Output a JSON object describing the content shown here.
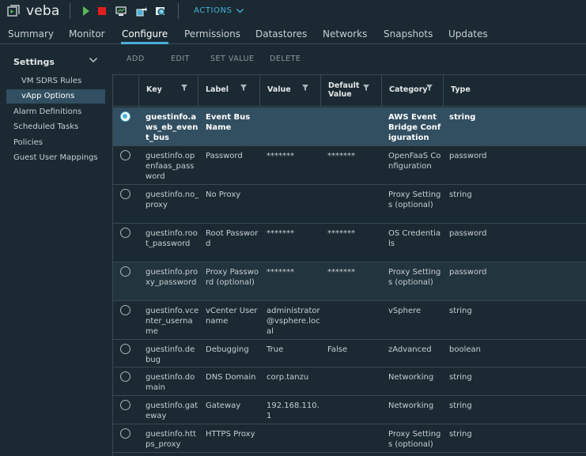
{
  "header": {
    "title": "veba",
    "actions_label": "ACTIONS"
  },
  "tabs": [
    "Summary",
    "Monitor",
    "Configure",
    "Permissions",
    "Datastores",
    "Networks",
    "Snapshots",
    "Updates"
  ],
  "active_tab": "Configure",
  "sidebar": {
    "heading": "Settings",
    "items": [
      "VM SDRS Rules",
      "vApp Options",
      "Alarm Definitions",
      "Scheduled Tasks",
      "Policies",
      "Guest User Mappings"
    ],
    "selected": "vApp Options"
  },
  "toolbar": {
    "add": "ADD",
    "edit": "EDIT",
    "set_value": "SET VALUE",
    "delete": "DELETE"
  },
  "grid": {
    "columns": [
      "Key",
      "Label",
      "Value",
      "Default Value",
      "Category",
      "Type"
    ],
    "rows": [
      {
        "key": "guestinfo.aws_eb_event_bus",
        "label": "Event Bus Name",
        "value": "",
        "default": "",
        "category": "AWS EventBridge Configuration",
        "type": "string",
        "selected": true
      },
      {
        "key": "guestinfo.openfaas_password",
        "label": "Password",
        "value": "*******",
        "default": "*******",
        "category": "OpenFaaS Configuration",
        "type": "password"
      },
      {
        "key": "guestinfo.no_proxy",
        "label": "No Proxy",
        "value": "",
        "default": "",
        "category": "Proxy Settings (optional)",
        "type": "string"
      },
      {
        "key": "guestinfo.root_password",
        "label": "Root Password",
        "value": "*******",
        "default": "*******",
        "category": "OS Credentials",
        "type": "password"
      },
      {
        "key": "guestinfo.proxy_password",
        "label": "Proxy Password (optional)",
        "value": "*******",
        "default": "*******",
        "category": "Proxy Settings (optional)",
        "type": "password",
        "alt": true
      },
      {
        "key": "guestinfo.vcenter_username",
        "label": "vCenter Username",
        "value": "administrator@vsphere.local",
        "default": "",
        "category": "vSphere",
        "type": "string"
      },
      {
        "key": "guestinfo.debug",
        "label": "Debugging",
        "value": "True",
        "default": "False",
        "category": "zAdvanced",
        "type": "boolean"
      },
      {
        "key": "guestinfo.domain",
        "label": "DNS Domain",
        "value": "corp.tanzu",
        "default": "",
        "category": "Networking",
        "type": "string"
      },
      {
        "key": "guestinfo.gateway",
        "label": "Gateway",
        "value": "192.168.110.1",
        "default": "",
        "category": "Networking",
        "type": "string"
      },
      {
        "key": "guestinfo.https_proxy",
        "label": "HTTPS Proxy",
        "value": "",
        "default": "",
        "category": "Proxy Settings (optional)",
        "type": "string"
      }
    ]
  },
  "icons": {
    "vm": "vm-icon",
    "power_on": "play-icon",
    "power_off": "stop-icon",
    "console": "console-icon",
    "migrate": "migrate-icon",
    "snapshot": "snapshot-icon",
    "filter": "filter-icon",
    "chevron": "chevron-down-icon"
  },
  "colors": {
    "accent": "#49afd9",
    "selected_row": "#324f61",
    "power_on": "#5cb85c",
    "power_off": "#e02020"
  }
}
